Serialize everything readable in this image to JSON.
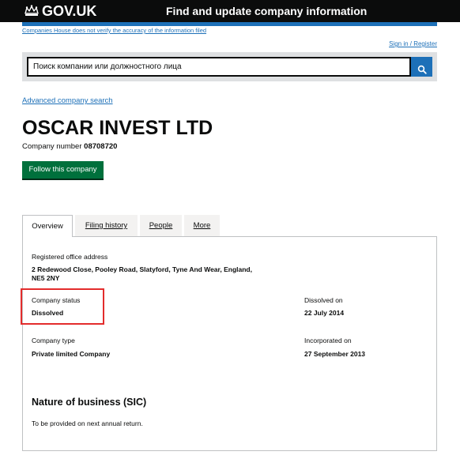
{
  "header": {
    "brand": "GOV.UK",
    "service_name": "Find and update company information",
    "disclaimer": "Companies House does not verify the accuracy of the information filed",
    "signin": "Sign in / Register"
  },
  "search": {
    "value": "Поиск компании или должностного лица",
    "placeholder": "Поиск компании или должностного лица",
    "button_icon": "search-icon"
  },
  "advanced_search": "Advanced company search",
  "company": {
    "name": "OSCAR INVEST LTD",
    "number_label": "Company number",
    "number": "08708720",
    "follow_button": "Follow this company"
  },
  "tabs": [
    {
      "label": "Overview",
      "active": true
    },
    {
      "label": "Filing history",
      "active": false
    },
    {
      "label": "People",
      "active": false
    },
    {
      "label": "More",
      "active": false
    }
  ],
  "overview": {
    "registered_office_label": "Registered office address",
    "registered_office_value": "2 Redewood Close, Pooley Road, Slatyford, Tyne And Wear, England, NE5 2NY",
    "status_label": "Company status",
    "status_value": "Dissolved",
    "dissolved_label": "Dissolved on",
    "dissolved_value": "22 July 2014",
    "type_label": "Company type",
    "type_value": "Private limited Company",
    "incorporated_label": "Incorporated on",
    "incorporated_value": "27 September 2013",
    "sic_heading": "Nature of business (SIC)",
    "sic_text": "To be provided on next annual return."
  },
  "colors": {
    "header_bg": "#0b0c0c",
    "accent_blue": "#1d70b8",
    "follow_green": "#00703c",
    "highlight_red": "#e32c2c"
  }
}
